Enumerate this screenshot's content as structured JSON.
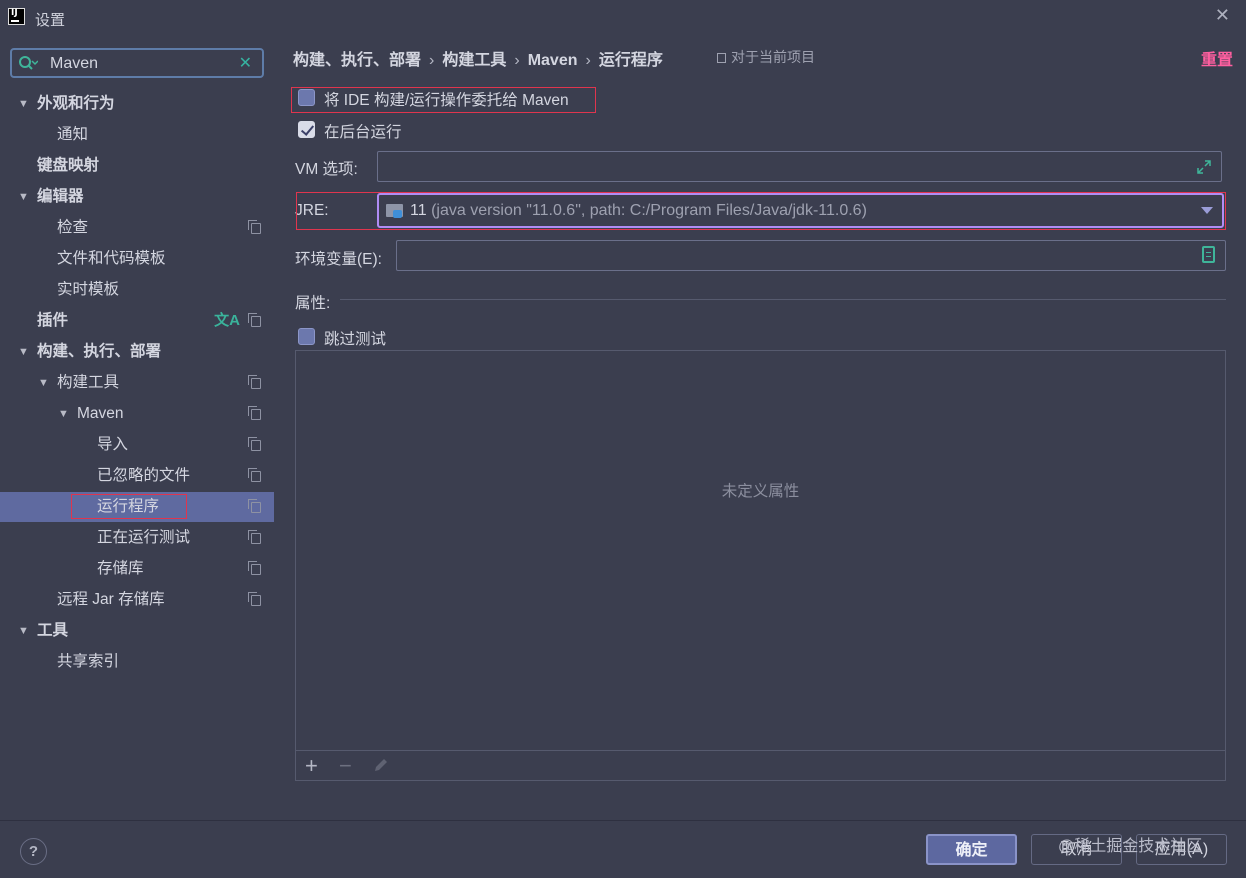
{
  "window": {
    "app_icon_text": "IJ",
    "title": "设置",
    "close_glyph": "✕"
  },
  "sidebar": {
    "search": {
      "value": "Maven",
      "clear_glyph": "✕"
    },
    "tree": [
      {
        "label": "外观和行为",
        "expanded": true,
        "bold": true
      },
      {
        "label": "通知"
      },
      {
        "label": "键盘映射",
        "bold": true
      },
      {
        "label": "编辑器",
        "expanded": true,
        "bold": true
      },
      {
        "label": "检查"
      },
      {
        "label": "文件和代码模板"
      },
      {
        "label": "实时模板"
      },
      {
        "label": "插件",
        "bold": true,
        "badge": "文A"
      },
      {
        "label": "构建、执行、部署",
        "expanded": true,
        "bold": true
      },
      {
        "label": "构建工具",
        "expanded": true
      },
      {
        "label": "Maven",
        "expanded": true
      },
      {
        "label": "导入"
      },
      {
        "label": "已忽略的文件"
      },
      {
        "label": "运行程序",
        "selected": true
      },
      {
        "label": "正在运行测试"
      },
      {
        "label": "存储库"
      },
      {
        "label": "远程 Jar 存储库"
      },
      {
        "label": "工具",
        "expanded": true,
        "bold": true
      },
      {
        "label": "共享索引"
      }
    ]
  },
  "main": {
    "breadcrumb": [
      "构建、执行、部署",
      "构建工具",
      "Maven",
      "运行程序"
    ],
    "breadcrumb_separator": "›",
    "scope_hint": "对于当前项目",
    "reset_label": "重置",
    "delegate_checkbox": {
      "label": "将 IDE 构建/运行操作委托给 Maven",
      "checked": false
    },
    "background_checkbox": {
      "label": "在后台运行",
      "checked": true
    },
    "vm_options": {
      "label": "VM 选项:",
      "value": ""
    },
    "jre": {
      "label": "JRE:",
      "version": "11",
      "detail": "(java version \"11.0.6\", path: C:/Program Files/Java/jdk-11.0.6)"
    },
    "env_vars": {
      "label": "环境变量(E):",
      "value": ""
    },
    "properties": {
      "section_label": "属性:",
      "skip_tests": {
        "label": "跳过测试",
        "checked": false
      },
      "empty_text": "未定义属性",
      "add_glyph": "+",
      "remove_glyph": "−"
    }
  },
  "footer": {
    "help_glyph": "?",
    "ok_label": "确定",
    "cancel_label": "取消",
    "apply_label": "应用(A)",
    "watermark": "@稀土掘金技术社区"
  },
  "colors": {
    "background": "#3b3e4f",
    "selection": "#5f6aa0",
    "accent_focus": "#b08cf5",
    "reset_link": "#ff5fa0",
    "annotation_red": "#e0354e",
    "icon_green": "#3fb59a"
  }
}
